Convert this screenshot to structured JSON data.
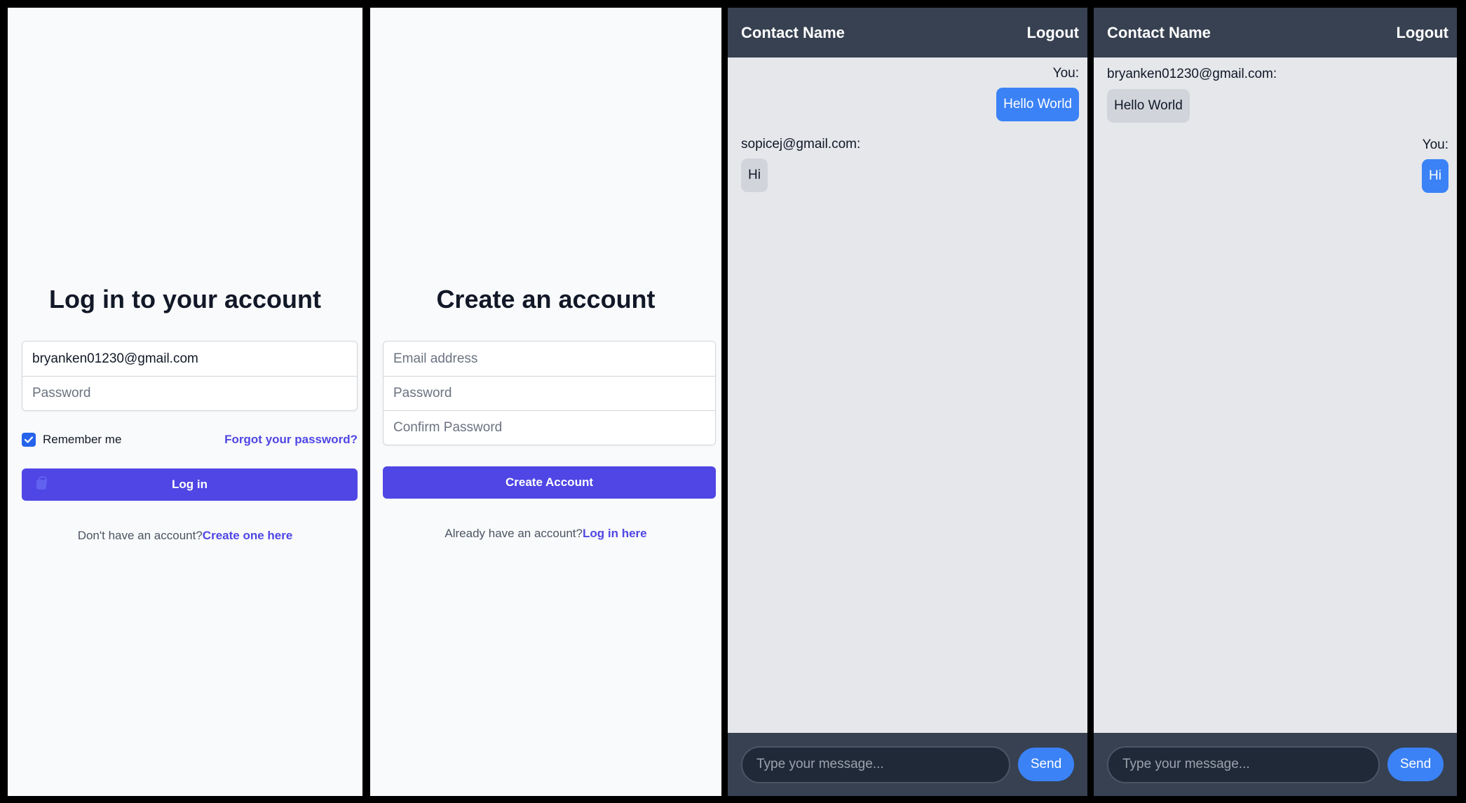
{
  "login": {
    "title": "Log in to your account",
    "email_value": "bryanken01230@gmail.com",
    "password_placeholder": "Password",
    "remember_label": "Remember me",
    "forgot_link": "Forgot your password?",
    "login_button": "Log in",
    "no_account_text": "Don't have an account?",
    "create_link": "Create one here"
  },
  "register": {
    "title": "Create an account",
    "email_placeholder": "Email address",
    "password_placeholder": "Password",
    "confirm_placeholder": "Confirm Password",
    "create_button": "Create Account",
    "have_account_text": "Already have an account?",
    "login_link": "Log in here"
  },
  "chat1": {
    "contact_name": "Contact Name",
    "logout": "Logout",
    "messages": [
      {
        "sender": "You:",
        "text": "Hello World"
      },
      {
        "sender": "sopicej@gmail.com:",
        "text": "Hi"
      }
    ],
    "input_placeholder": "Type your message...",
    "send": "Send"
  },
  "chat2": {
    "contact_name": "Contact Name",
    "logout": "Logout",
    "messages": [
      {
        "sender": "bryanken01230@gmail.com:",
        "text": "Hello World"
      },
      {
        "sender": "You:",
        "text": "Hi"
      }
    ],
    "input_placeholder": "Type your message...",
    "send": "Send"
  },
  "colors": {
    "accent": "#4f46e5",
    "chat_blue": "#3b82f6",
    "header": "#374151"
  }
}
